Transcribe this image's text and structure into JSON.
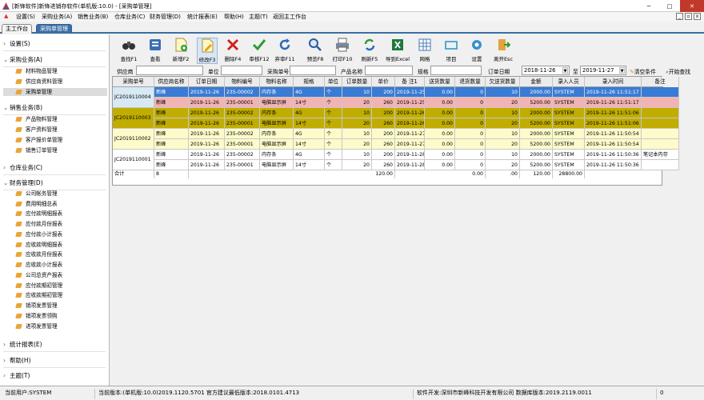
{
  "window": {
    "title": "[新锋软件]新锋进销存软件(单机版:10.0) - [采购单管理]",
    "minimize": "─",
    "maximize": "□",
    "close": "✕"
  },
  "menu": [
    {
      "label": "设置(S)"
    },
    {
      "label": "采购业务(A)"
    },
    {
      "label": "销售业务(B)"
    },
    {
      "label": "仓库业务(C)"
    },
    {
      "label": "财务管理(D)"
    },
    {
      "label": "统计报表(E)"
    },
    {
      "label": "帮助(H)"
    },
    {
      "label": "主题(T)"
    },
    {
      "label": "返回主工作台"
    }
  ],
  "mdi_buttons": [
    "_",
    "▫",
    "x"
  ],
  "tabs": [
    {
      "label": "主工作台"
    },
    {
      "label": "采购单管理"
    }
  ],
  "sidebar": {
    "groups": [
      {
        "label": "设置(S)",
        "expanded": false,
        "items": []
      },
      {
        "label": "采购业务(A)",
        "expanded": true,
        "items": [
          {
            "label": "材料物品管理"
          },
          {
            "label": "供应商资料管理"
          },
          {
            "label": "采购单管理"
          }
        ]
      },
      {
        "label": "销售业务(B)",
        "expanded": true,
        "items": [
          {
            "label": "产品物料管理"
          },
          {
            "label": "客户资料管理"
          },
          {
            "label": "客户报价单管理"
          },
          {
            "label": "销售订单管理"
          }
        ]
      },
      {
        "label": "仓库业务(C)",
        "expanded": false,
        "items": []
      },
      {
        "label": "财务管理(D)",
        "expanded": true,
        "items": [
          {
            "label": "公司帐务管理"
          },
          {
            "label": "费用明细总表"
          },
          {
            "label": "应付款明细报表"
          },
          {
            "label": "应付款月份报表"
          },
          {
            "label": "应付款小计报表"
          },
          {
            "label": "应收款明细报表"
          },
          {
            "label": "应收款月份报表"
          },
          {
            "label": "应收款小计报表"
          },
          {
            "label": "公司总资产报表"
          },
          {
            "label": "应付款期初管理"
          },
          {
            "label": "应收款期初管理"
          },
          {
            "label": "销项发票管理"
          },
          {
            "label": "销项发票领购"
          },
          {
            "label": "进项发票管理"
          }
        ]
      },
      {
        "label": "统计报表(E)",
        "expanded": false,
        "items": []
      },
      {
        "label": "帮助(H)",
        "expanded": false,
        "items": []
      },
      {
        "label": "主题(T)",
        "expanded": false,
        "items": []
      }
    ]
  },
  "toolbar": [
    {
      "label": "查找F1",
      "icon": "binoculars-icon"
    },
    {
      "label": "查看",
      "icon": "view-icon"
    },
    {
      "label": "新增F2",
      "icon": "new-icon"
    },
    {
      "label": "修改F3",
      "icon": "edit-icon"
    },
    {
      "label": "删除F4",
      "icon": "delete-icon"
    },
    {
      "label": "审核F12",
      "icon": "check-icon"
    },
    {
      "label": "弃审F11",
      "icon": "undo-icon"
    },
    {
      "label": "预览F8",
      "icon": "preview-icon"
    },
    {
      "label": "打印F10",
      "icon": "printer-icon"
    },
    {
      "label": "刷新F5",
      "icon": "refresh-icon"
    },
    {
      "label": "导到Excel",
      "icon": "excel-icon"
    },
    {
      "label": "网格",
      "icon": "grid-icon"
    },
    {
      "label": "项目",
      "icon": "project-icon"
    },
    {
      "label": "设置",
      "icon": "settings-icon"
    },
    {
      "label": "离开Esc",
      "icon": "exit-icon"
    }
  ],
  "filter": {
    "supplier": "供应商",
    "unit": "单位",
    "order_no": "采购单号",
    "product": "产品名称",
    "spec": "规格",
    "date_label": "订单日期",
    "date_from": "2018-11-26",
    "to": "至",
    "date_to": "2019-11-27",
    "clear": "清空条件",
    "search": "开始查找"
  },
  "grid": {
    "columns": [
      "采购单号",
      "供应商名称",
      "订单日期",
      "物料编号",
      "物料名称",
      "规格",
      "单位",
      "订单数量",
      "单价",
      "备 注1",
      "送货数量",
      "退货数量",
      "欠送货数量",
      "金额",
      "录入人员",
      "录入时间",
      "备注"
    ],
    "groups": [
      {
        "order_no": "JC2019110004",
        "color": "#d7e9f5",
        "rows": [
          {
            "c": [
              "新峰",
              "2019-11-26",
              "235-00002",
              "内存条",
              "4G",
              "个",
              "10",
              "200",
              "2019-11-25",
              "0.00",
              "0",
              "10",
              "2000.00",
              "SYSTEM",
              "2019-11-26 11:51:17",
              ""
            ],
            "bg": "#3a7bd5",
            "fg": "#fff"
          },
          {
            "c": [
              "新峰",
              "2019-11-26",
              "235-00001",
              "电脑显示屏",
              "14寸",
              "个",
              "20",
              "260",
              "2019-11-25",
              "0.00",
              "0",
              "20",
              "5200.00",
              "SYSTEM",
              "2019-11-26 11:51:17",
              ""
            ],
            "bg": "#f4b3b3",
            "fg": "#000"
          }
        ]
      },
      {
        "order_no": "JC2019110003",
        "color": "#c0ad00",
        "rows": [
          {
            "c": [
              "新峰",
              "2019-11-26",
              "235-00002",
              "内存条",
              "4G",
              "个",
              "10",
              "200",
              "2019-11-26",
              "0.00",
              "0",
              "10",
              "2000.00",
              "SYSTEM",
              "2019-11-26 11:51:06",
              ""
            ],
            "bg": "#c0ad00",
            "fg": "#000"
          },
          {
            "c": [
              "新峰",
              "2019-11-26",
              "235-00001",
              "电脑显示屏",
              "14寸",
              "个",
              "20",
              "260",
              "2019-11-26",
              "0.00",
              "0",
              "20",
              "5200.00",
              "SYSTEM",
              "2019-11-26 11:51:06",
              ""
            ],
            "bg": "#c0ad00",
            "fg": "#000"
          }
        ]
      },
      {
        "order_no": "JC2019110002",
        "color": "#fdfbc9",
        "rows": [
          {
            "c": [
              "新峰",
              "2019-11-26",
              "235-00002",
              "内存条",
              "4G",
              "个",
              "10",
              "200",
              "2019-11-27",
              "0.00",
              "0",
              "10",
              "2000.00",
              "SYSTEM",
              "2019-11-26 11:50:54",
              ""
            ],
            "bg": "#fdfbc9",
            "fg": "#000"
          },
          {
            "c": [
              "新峰",
              "2019-11-26",
              "235-00001",
              "电脑显示屏",
              "14寸",
              "个",
              "20",
              "260",
              "2019-11-27",
              "0.00",
              "0",
              "20",
              "5200.00",
              "SYSTEM",
              "2019-11-26 11:50:54",
              ""
            ],
            "bg": "#fdfbc9",
            "fg": "#000"
          }
        ]
      },
      {
        "order_no": "JC2019110001",
        "color": "#ffffff",
        "rows": [
          {
            "c": [
              "新峰",
              "2019-11-26",
              "235-00002",
              "内存条",
              "4G",
              "个",
              "10",
              "200",
              "2019-11-28",
              "0.00",
              "0",
              "10",
              "2000.00",
              "SYSTEM",
              "2019-11-26 11:50:36",
              "笔记本内存"
            ],
            "bg": "#ffffff",
            "fg": "#000"
          },
          {
            "c": [
              "新峰",
              "2019-11-26",
              "235-00001",
              "电脑显示屏",
              "14寸",
              "个",
              "20",
              "260",
              "2019-11-28",
              "0.00",
              "0",
              "20",
              "5200.00",
              "SYSTEM",
              "2019-11-26 11:50:36",
              ""
            ],
            "bg": "#ffffff",
            "fg": "#000"
          }
        ]
      }
    ],
    "total": {
      "label": "合计",
      "count": "8",
      "qty": "120.00",
      "ship": "0.00",
      "ret": ".00",
      "owe": "120.00",
      "amt": "28800.00"
    }
  },
  "status": {
    "user": "当前用户:SYSTEM",
    "version": "当前版本:(单机版:10.0)2019.1120.5701 官方建议最低版本:2018.0101.4713",
    "dev": "软件开发:深圳市新峰科技开发有限公司 数据库版本:2019.2119.0011",
    "extra": "0"
  }
}
